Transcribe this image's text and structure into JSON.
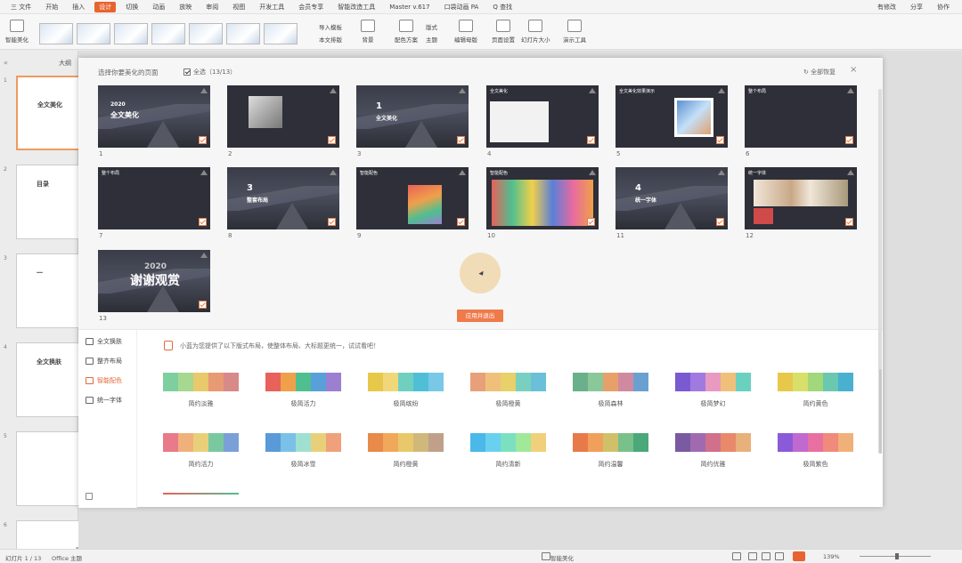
{
  "menubar": {
    "items": [
      "三 文件",
      "开始",
      "插入",
      "设计",
      "切换",
      "动画",
      "放映",
      "审阅",
      "视图",
      "开发工具",
      "会员专享",
      "智能改造工具",
      "Master v.617",
      "口袋动画 PA",
      "Q 查找"
    ],
    "active_index": 3,
    "right": [
      "有修改",
      "分享",
      "协作"
    ]
  },
  "ribbon": {
    "smart_beautify": "智能美化",
    "import_template": "导入模板",
    "docx_layout": "本文排版",
    "background": "背景",
    "color_scheme": "配色方案",
    "layout": "版式",
    "theme": "主题",
    "edit_master": "编辑母版",
    "page_setup": "页面设置",
    "slide_size": "幻灯片大小",
    "show_tools": "演示工具"
  },
  "left_panel": {
    "tab": "大纲",
    "slides": [
      {
        "num": "1",
        "text": "全文美化"
      },
      {
        "num": "2",
        "text": "目录"
      },
      {
        "num": "3",
        "text": "一"
      },
      {
        "num": "4",
        "text": "全文换肤"
      },
      {
        "num": "5",
        "text": ""
      },
      {
        "num": "6",
        "text": ""
      }
    ]
  },
  "dialog": {
    "title": "选择你要美化的页面",
    "select_all": "全选（13/13）",
    "reset": "↻ 全部恢复",
    "close": "×",
    "slides": [
      {
        "num": "1",
        "title": "全文美化",
        "year": "2020"
      },
      {
        "num": "2",
        "title": ""
      },
      {
        "num": "3",
        "title": "全文美化",
        "big": "1"
      },
      {
        "num": "4",
        "title": "全文美化"
      },
      {
        "num": "5",
        "title": "全文美化效果演示"
      },
      {
        "num": "6",
        "title": "整个布局"
      },
      {
        "num": "7",
        "title": "整个布局"
      },
      {
        "num": "8",
        "title": "整套布局",
        "big": "3"
      },
      {
        "num": "9",
        "title": "智能配色"
      },
      {
        "num": "10",
        "title": "智能配色"
      },
      {
        "num": "11",
        "title": "统一字体",
        "big": "4"
      },
      {
        "num": "12",
        "title": "统一字体"
      },
      {
        "num": "13",
        "title": "谢谢观赏",
        "year": "2020"
      }
    ],
    "apply_button": "应用并退出",
    "nav": [
      {
        "label": "全文换肤",
        "active": false
      },
      {
        "label": "整齐布局",
        "active": false
      },
      {
        "label": "智能配色",
        "active": true
      },
      {
        "label": "统一字体",
        "active": false
      }
    ],
    "hint": "小蓝为您提供了以下版式布局，使整体布局、大标题更统一，试试看吧！",
    "palettes": [
      {
        "name": "简约淡雅",
        "colors": [
          "#7dcfa0",
          "#a6d88f",
          "#e8c96b",
          "#e89a72",
          "#d88a88"
        ]
      },
      {
        "name": "极简活力",
        "colors": [
          "#e8615a",
          "#f0a04a",
          "#4fbf8f",
          "#5aa0d8",
          "#9b7fd0"
        ]
      },
      {
        "name": "极简缤纷",
        "colors": [
          "#e8c84a",
          "#f0d77a",
          "#6fd0c0",
          "#4fbfd8",
          "#7ac8e8"
        ]
      },
      {
        "name": "极简橙黄",
        "colors": [
          "#e8a07a",
          "#f0c07a",
          "#e8d06a",
          "#7ad0c0",
          "#6ac0d8"
        ]
      },
      {
        "name": "极简森林",
        "colors": [
          "#6ab08a",
          "#8ac89a",
          "#e8a06a",
          "#d08aa0",
          "#6aa0d0"
        ]
      },
      {
        "name": "极简梦幻",
        "colors": [
          "#7a5ad0",
          "#a07ae0",
          "#e89ac0",
          "#f0c07a",
          "#6ad0c0"
        ]
      },
      {
        "name": "简约黄色",
        "colors": [
          "#e8c84a",
          "#d8e06a",
          "#a0d87a",
          "#6ac8b0",
          "#4ab0d0"
        ]
      },
      {
        "name": "简约活力",
        "colors": [
          "#e87a8a",
          "#f0b07a",
          "#e8d07a",
          "#7ac8a0",
          "#7aa0d8"
        ]
      },
      {
        "name": "极简冰雪",
        "colors": [
          "#5a9ad8",
          "#7ac0e8",
          "#a0e0d0",
          "#e8d07a",
          "#f0a07a"
        ]
      },
      {
        "name": "简约橙黄",
        "colors": [
          "#e88a4a",
          "#f0a85a",
          "#e8c86a",
          "#d0b87a",
          "#c0a08a"
        ]
      },
      {
        "name": "简约清新",
        "colors": [
          "#4ab8e8",
          "#6ad0f0",
          "#7ae0c0",
          "#a0e89a",
          "#f0d07a"
        ]
      },
      {
        "name": "简约温馨",
        "colors": [
          "#e87a4a",
          "#f0a05a",
          "#d0c06a",
          "#7ac08a",
          "#4aa87a"
        ]
      },
      {
        "name": "简约优雅",
        "colors": [
          "#7a5aa0",
          "#a06ab0",
          "#d0708a",
          "#e88a6a",
          "#e8b07a"
        ]
      },
      {
        "name": "极简紫色",
        "colors": [
          "#8a5ad8",
          "#c06ad0",
          "#e870a0",
          "#f08a7a",
          "#f0b07a"
        ]
      }
    ]
  },
  "status": {
    "slide_info": "幻灯片 1 / 13",
    "theme": "Office 主题",
    "smart": "智能美化",
    "zoom": "139%"
  }
}
